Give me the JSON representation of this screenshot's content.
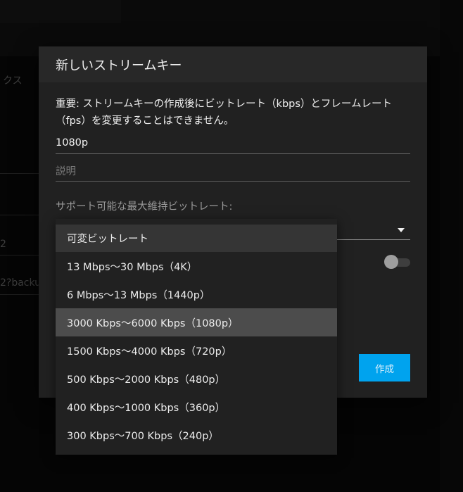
{
  "background": {
    "fragments": [
      "クス",
      "2",
      "2?backu"
    ]
  },
  "modal": {
    "title": "新しいストリームキー",
    "notice": "重要: ストリームキーの作成後にビットレート（kbps）とフレームレート（fps）を変更することはできません。",
    "name_value": "1080p",
    "description_placeholder": "説明",
    "bitrate_label": "サポート可能な最大維持ビットレート:",
    "create_button": "作成"
  },
  "dropdown": {
    "options": [
      "可変ビットレート",
      "13 Mbps〜30 Mbps（4K）",
      "6 Mbps〜13 Mbps（1440p）",
      "3000 Kbps〜6000 Kbps（1080p）",
      "1500 Kbps〜4000 Kbps（720p）",
      "500 Kbps〜2000 Kbps（480p）",
      "400 Kbps〜1000 Kbps（360p）",
      "300 Kbps〜700 Kbps（240p）"
    ],
    "highlighted_option": "3000 Kbps〜6000 Kbps（1080p）"
  },
  "colors": {
    "accent": "#00a3ee",
    "modal_bg": "#212121",
    "highlight": "#4c4c4c"
  }
}
